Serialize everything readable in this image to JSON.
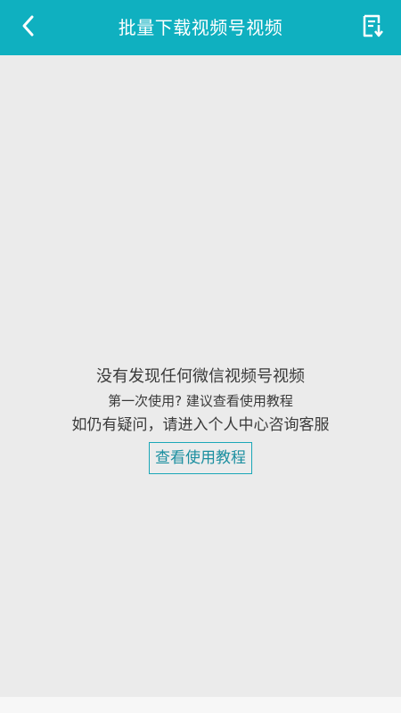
{
  "header": {
    "title": "批量下载视频号视频",
    "back_icon": "chevron-left-icon",
    "download_icon": "download-list-icon",
    "background": "#0fb0c0"
  },
  "empty_state": {
    "line1": "没有发现任何微信视频号视频",
    "line2": "第一次使用? 建议查看使用教程",
    "line3": "如仍有疑问，请进入个人中心咨询客服",
    "button_label": "查看使用教程",
    "accent": "#1aa7b8"
  }
}
